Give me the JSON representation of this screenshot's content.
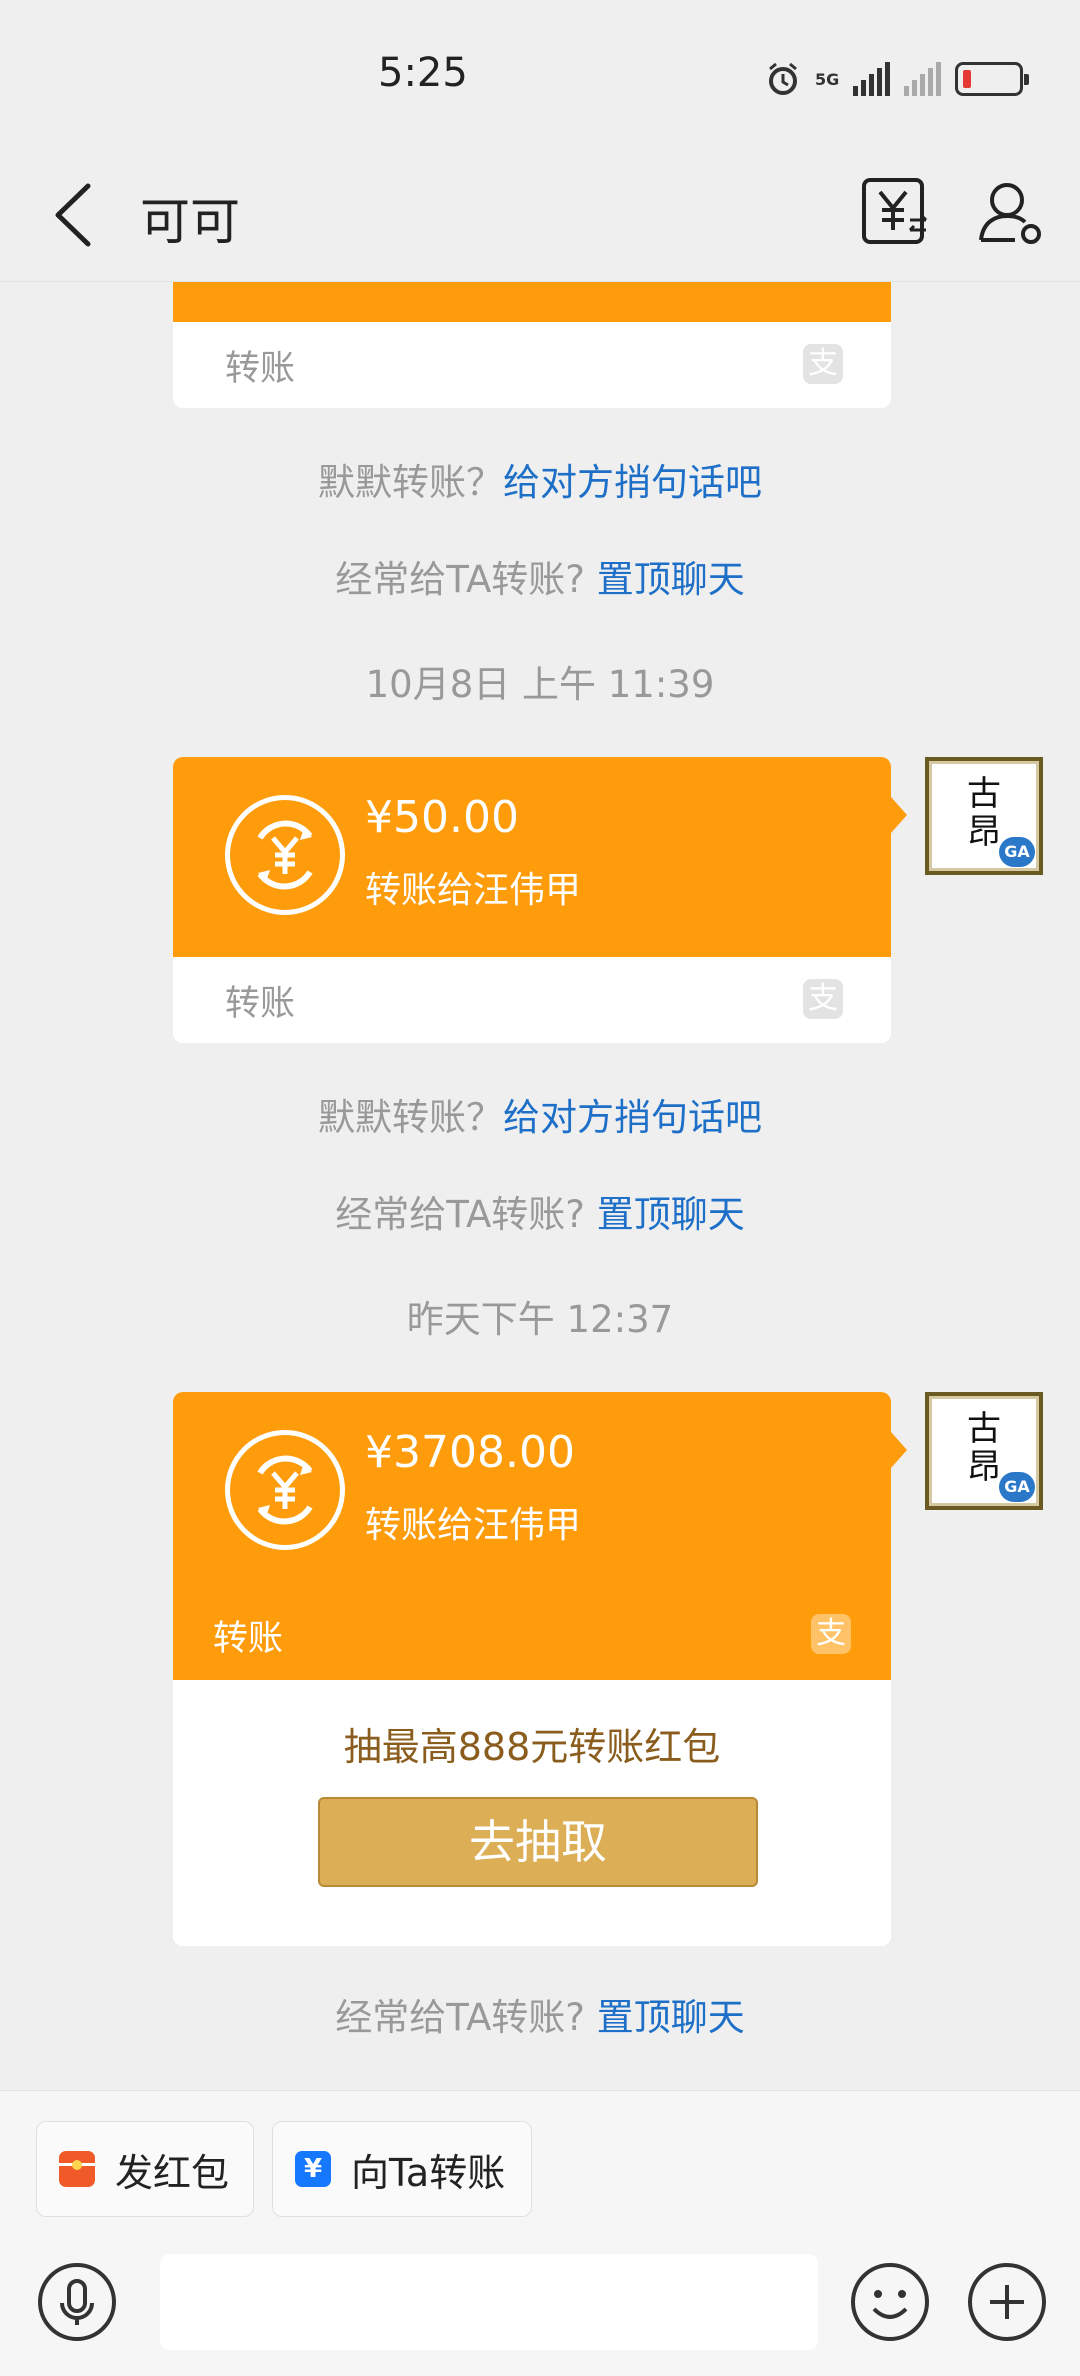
{
  "status_bar": {
    "time": "5:25",
    "network": "5G"
  },
  "header": {
    "title": "可可",
    "back_icon": "chevron-left-icon",
    "transfer_icon": "yuan-transfer-icon",
    "profile_icon": "user-settings-icon"
  },
  "chat": {
    "partial_card": {
      "footer_label": "转账"
    },
    "prompts_1": {
      "silent_text": "默默转账？",
      "silent_link": "给对方捎句话吧",
      "frequent_text": "经常给TA转账?",
      "frequent_link": "置顶聊天"
    },
    "timestamp_1": "10月8日 上午 11:39",
    "transfer_1": {
      "amount": "¥50.00",
      "recipient": "转账给汪伟甲",
      "footer_label": "转账"
    },
    "prompts_2": {
      "silent_text": "默默转账？",
      "silent_link": "给对方捎句话吧",
      "frequent_text": "经常给TA转账?",
      "frequent_link": "置顶聊天"
    },
    "timestamp_2": "昨天下午 12:37",
    "transfer_2": {
      "amount": "¥3708.00",
      "recipient": "转账给汪伟甲",
      "footer_label": "转账",
      "promo_text": "抽最高888元转账红包",
      "promo_button": "去抽取"
    },
    "prompts_3": {
      "frequent_text": "经常给TA转账?",
      "frequent_link": "置顶聊天"
    },
    "avatar": {
      "chars": "古昂",
      "badge": "GA"
    },
    "footer_logo": "支"
  },
  "bottom_bar": {
    "red_packet_label": "发红包",
    "transfer_label": "向Ta转账",
    "message_placeholder": ""
  },
  "colors": {
    "accent_orange": "#ff9c0c",
    "link_blue": "#1d6fc7",
    "gold_button": "#dcae56"
  }
}
